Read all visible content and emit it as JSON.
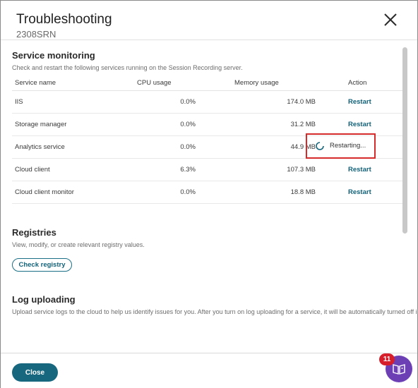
{
  "dialog": {
    "title": "Troubleshooting",
    "subtitle": "2308SRN"
  },
  "service_monitoring": {
    "title": "Service monitoring",
    "description": "Check and restart the following services running on the Session Recording server.",
    "columns": [
      "Service name",
      "CPU usage",
      "Memory usage",
      "Action"
    ],
    "rows": [
      {
        "name": "IIS",
        "cpu": "0.0%",
        "memory": "174.0 MB",
        "action": "Restart"
      },
      {
        "name": "Storage manager",
        "cpu": "0.0%",
        "memory": "31.2 MB",
        "action": "Restart"
      },
      {
        "name": "Analytics service",
        "cpu": "0.0%",
        "memory": "44.9 MB",
        "action": "Restarting..."
      },
      {
        "name": "Cloud client",
        "cpu": "6.3%",
        "memory": "107.3 MB",
        "action": "Restart"
      },
      {
        "name": "Cloud client monitor",
        "cpu": "0.0%",
        "memory": "18.8 MB",
        "action": "Restart"
      }
    ]
  },
  "registries": {
    "title": "Registries",
    "description": "View, modify, or create relevant registry values.",
    "button_label": "Check registry"
  },
  "log_uploading": {
    "title": "Log uploading",
    "description": "Upload service logs to the cloud to help us identify issues for you. After you turn on log uploading for a service, it will be automatically turned off in"
  },
  "footer": {
    "close_label": "Close"
  },
  "help": {
    "badge_count": "11",
    "icon": "book-help-icon"
  },
  "colors": {
    "accent": "#17687f",
    "highlight": "#d62b2b",
    "help_fab": "#6c3fb5",
    "badge": "#d61f2b"
  }
}
